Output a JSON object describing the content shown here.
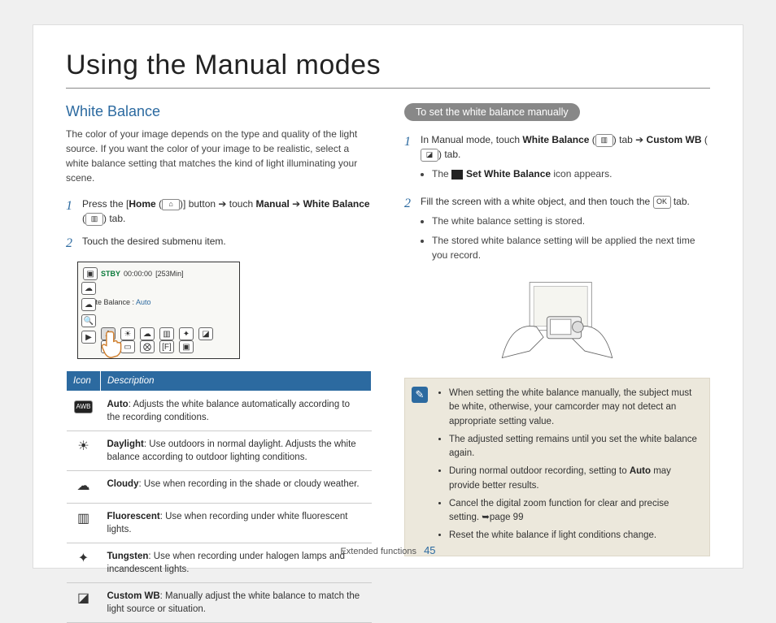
{
  "page_title": "Using the Manual modes",
  "footer": {
    "section": "Extended functions",
    "page": "45"
  },
  "left": {
    "heading": "White Balance",
    "intro": "The color of your image depends on the type and quality of the light source. If you want the color of your image to be realistic, select a white balance setting that matches the kind of light illuminating your scene.",
    "step1_a": "Press the [",
    "step1_home": "Home",
    "step1_b": " (",
    "step1_c": ")] button ➔ touch ",
    "step1_manual": "Manual",
    "step1_d": " ➔ ",
    "step1_wb": "White Balance",
    "step1_e": " (",
    "step1_f": ") tab.",
    "step2": "Touch the desired submenu item.",
    "screenshot": {
      "stby": "STBY",
      "time": "00:00:00",
      "remain": "[253Min]",
      "wb_label": "White Balance : ",
      "wb_value": "Auto"
    },
    "table": {
      "h_icon": "Icon",
      "h_desc": "Description",
      "rows": [
        {
          "icon": "AWB",
          "name": "Auto",
          "text": ": Adjusts the white balance automatically according to the recording conditions."
        },
        {
          "icon": "☀",
          "name": "Daylight",
          "text": ": Use outdoors in normal daylight. Adjusts the white balance according to outdoor lighting conditions."
        },
        {
          "icon": "☁",
          "name": "Cloudy",
          "text": ": Use when recording in the shade or cloudy weather."
        },
        {
          "icon": "▥",
          "name": "Fluorescent",
          "text": ": Use when recording under white fluorescent lights."
        },
        {
          "icon": "✦",
          "name": "Tungsten",
          "text": ": Use when recording under halogen lamps and incandescent lights."
        },
        {
          "icon": "◪",
          "name": "Custom WB",
          "text": ": Manually adjust the white balance to match the light source or situation."
        }
      ]
    }
  },
  "right": {
    "pill": "To set the white balance manually",
    "step1_a": "In Manual mode, touch ",
    "step1_wb": "White Balance",
    "step1_b": " (",
    "step1_c": ") tab ➔ ",
    "step1_cwb": "Custom WB",
    "step1_d": " (",
    "step1_e": ") tab.",
    "step1_bullet_a": "The ",
    "step1_bullet_b": "Set White Balance",
    "step1_bullet_c": " icon appears.",
    "step2_a": "Fill the screen with a white object, and then touch the ",
    "step2_ok": "OK",
    "step2_b": " tab.",
    "step2_bullets": [
      "The white balance setting is stored.",
      "The stored white balance setting will be applied the next time you record."
    ],
    "notes": [
      {
        "a": "When setting the white balance manually, the subject must be white, otherwise, your camcorder may not detect an appropriate setting value."
      },
      {
        "a": "The adjusted setting remains until you set the white balance again."
      },
      {
        "a": "During normal outdoor recording, setting to ",
        "b": "Auto",
        "c": " may provide better results."
      },
      {
        "a": "Cancel the digital zoom function for clear and precise setting. ➥page 99"
      },
      {
        "a": "Reset the white balance if light conditions change."
      }
    ]
  }
}
